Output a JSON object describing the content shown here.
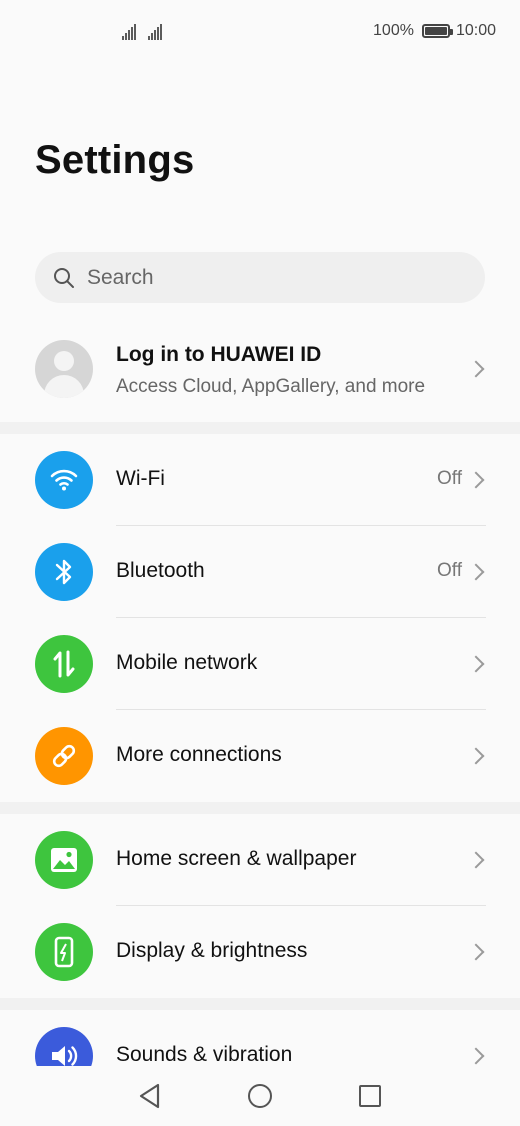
{
  "status_bar": {
    "battery_percent": "100%",
    "time": "10:00"
  },
  "page": {
    "title": "Settings"
  },
  "search": {
    "placeholder": "Search"
  },
  "account": {
    "title": "Log in to HUAWEI ID",
    "subtitle": "Access Cloud, AppGallery, and more"
  },
  "sections": [
    {
      "items": [
        {
          "label": "Wi-Fi",
          "value": "Off",
          "icon": "wifi-icon",
          "color": "#1aa0ec"
        },
        {
          "label": "Bluetooth",
          "value": "Off",
          "icon": "bluetooth-icon",
          "color": "#1aa0ec"
        },
        {
          "label": "Mobile network",
          "value": "",
          "icon": "mobile-data-icon",
          "color": "#3ec53e"
        },
        {
          "label": "More connections",
          "value": "",
          "icon": "link-icon",
          "color": "#ff9500"
        }
      ]
    },
    {
      "items": [
        {
          "label": "Home screen & wallpaper",
          "value": "",
          "icon": "wallpaper-icon",
          "color": "#3ec53e"
        },
        {
          "label": "Display & brightness",
          "value": "",
          "icon": "display-icon",
          "color": "#3ec53e"
        }
      ]
    },
    {
      "items": [
        {
          "label": "Sounds & vibration",
          "value": "",
          "icon": "speaker-icon",
          "color": "#3b5bdb"
        }
      ]
    }
  ]
}
